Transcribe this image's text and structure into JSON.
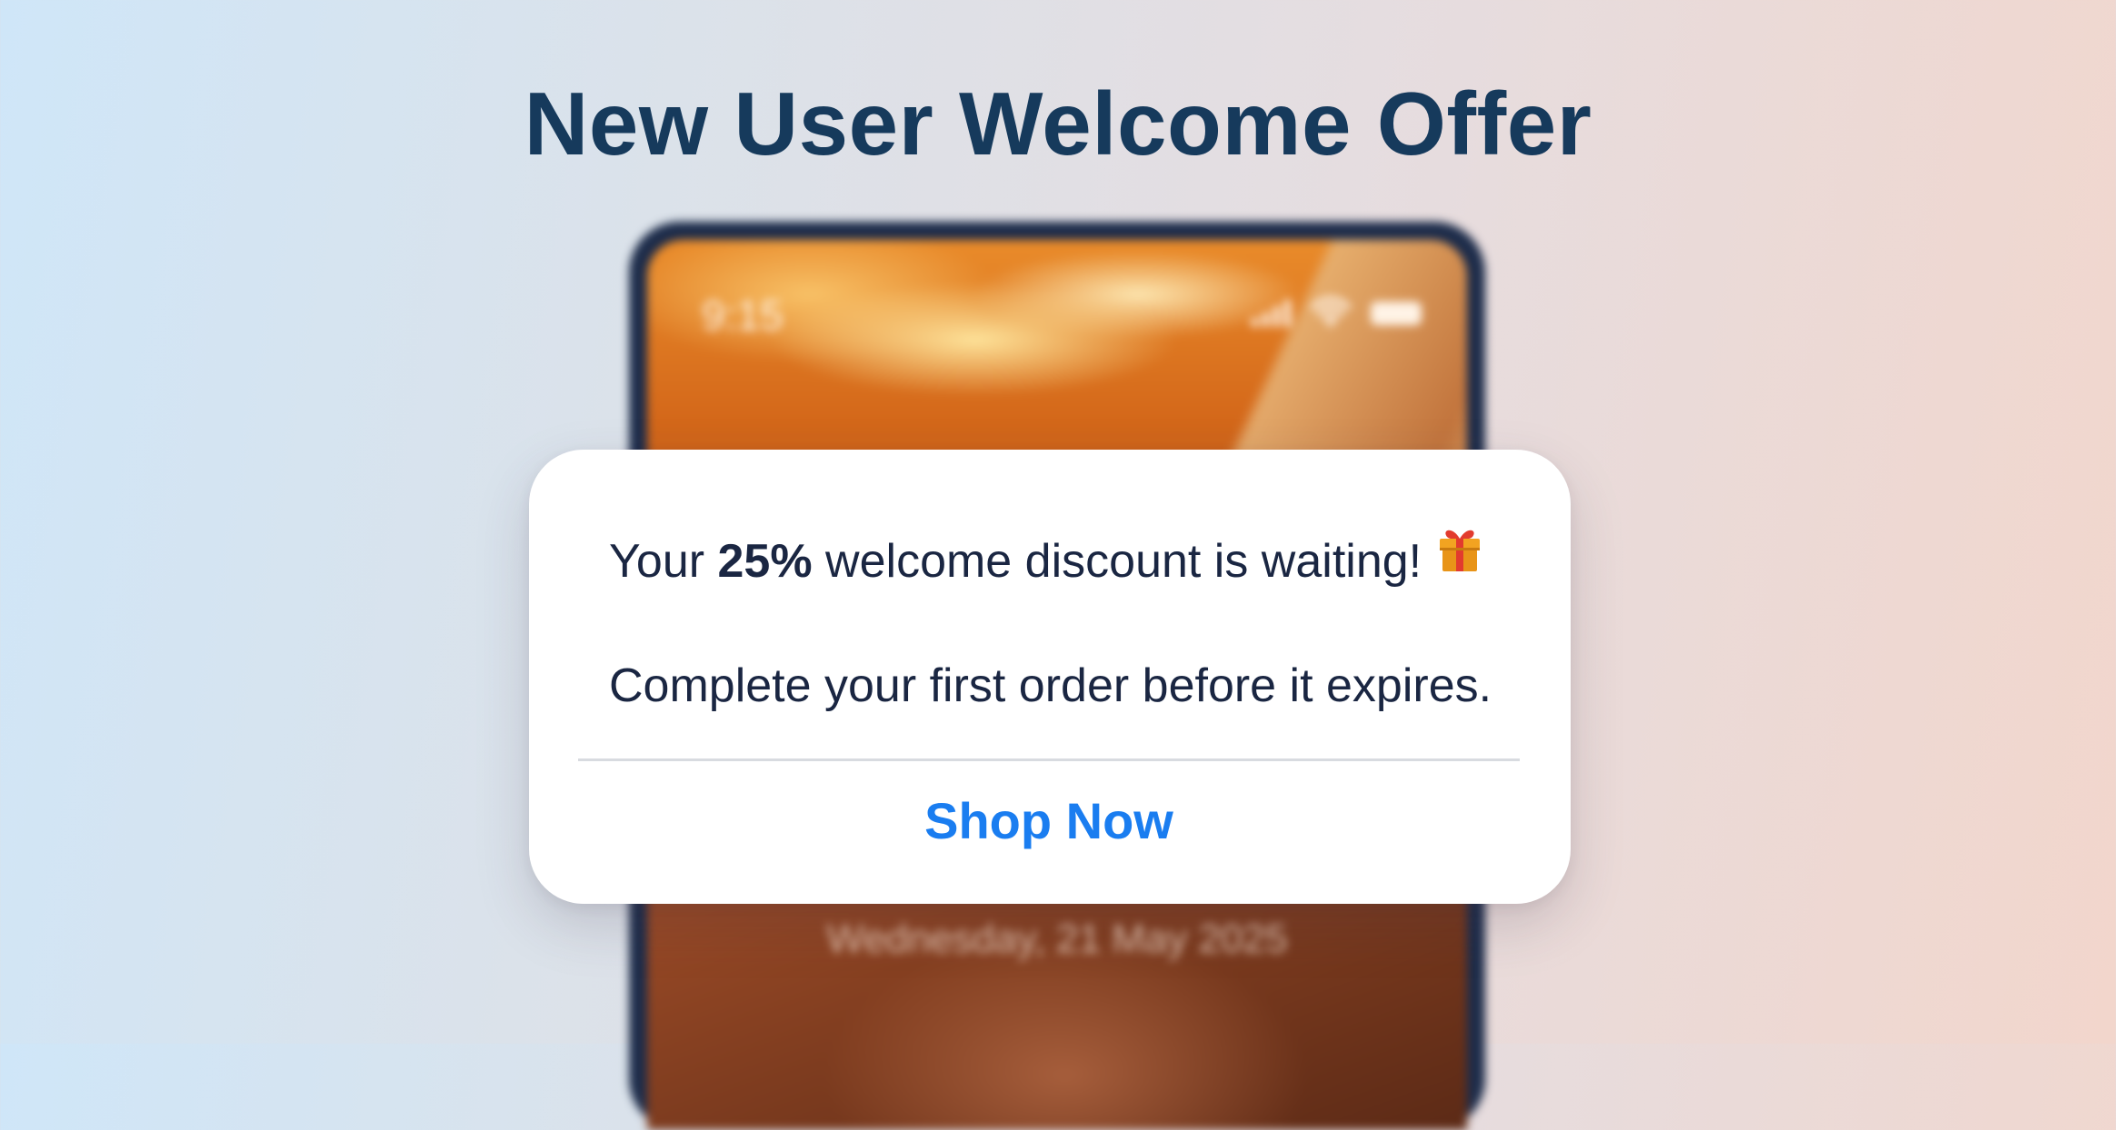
{
  "page": {
    "title": "New User Welcome Offer"
  },
  "phone": {
    "status_time": "9:15",
    "lock_date": "Wednesday, 21 May 2025",
    "icons": [
      "signal-icon",
      "wifi-icon",
      "battery-icon"
    ]
  },
  "dialog": {
    "line1_before": "Your ",
    "line1_highlight": "25%",
    "line1_after": " welcome discount is waiting!",
    "line1_icon": "gift-icon",
    "line2": "Complete your first order before it expires.",
    "action_label": "Shop Now"
  },
  "colors": {
    "title": "#163a5c",
    "text": "#1a2642",
    "action": "#1a7df0",
    "phone_frame": "#1d2c4a"
  }
}
